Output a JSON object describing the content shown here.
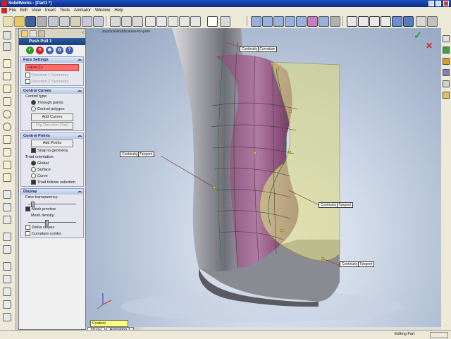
{
  "window": {
    "title": "SolidWorks - [Part1 *]"
  },
  "menu": [
    "File",
    "Edit",
    "View",
    "Insert",
    "Tools",
    "Animator",
    "Window",
    "Help"
  ],
  "panel": {
    "title": "Push Pull 1",
    "face_settings": {
      "header": "Face Settings",
      "face_value": "Face<1>",
      "dir1": "Direction 1 Symmetry",
      "dir2": "Direction 2 Symmetry"
    },
    "control_curves": {
      "header": "Control Curves",
      "type_label": "Control type:",
      "opt1": "Through points",
      "opt2": "Control polygon",
      "add_btn": "Add Curves",
      "flip_btn": "Flip Direction (Tab)"
    },
    "control_points": {
      "header": "Control Points",
      "add_btn": "Add Points",
      "snap": "Snap to geometry",
      "triad_label": "Triad orientation:",
      "global": "Global",
      "surface": "Surface",
      "curve": "Curve",
      "follow": "Triad follows selection"
    },
    "display": {
      "header": "Display",
      "transp": "Face transparency:",
      "mesh": "Mesh preview",
      "density": "Mesh density:",
      "zebra": "Zebra stripes",
      "comb": "Curvature combs"
    }
  },
  "viewport": {
    "tree_label": "JoystickModification-for-john",
    "callouts": [
      {
        "a": "Continuity",
        "b": "Curvature"
      },
      {
        "a": "Continuity",
        "b": "Tangent"
      },
      {
        "a": "Continuity",
        "b": "Tangent"
      },
      {
        "a": "Continuity",
        "b": "Tangent"
      }
    ]
  },
  "bottom": {
    "custom": "Custom",
    "tab_model": "Model",
    "tab_anim": "Animation 1",
    "status": "Editing Part"
  },
  "colors": {
    "face_highlight": "#ff6a6a",
    "surface_yellow": "#d9d98a",
    "body_gray": "#9a9aa2",
    "body_magenta": "#8a3a6a"
  }
}
